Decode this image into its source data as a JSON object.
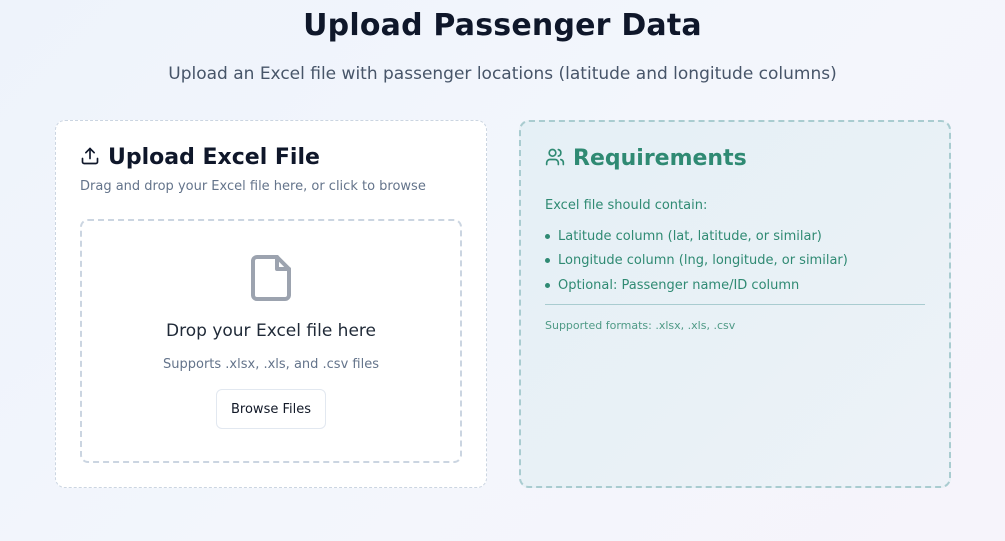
{
  "page": {
    "title": "Upload Passenger Data",
    "subtitle": "Upload an Excel file with passenger locations (latitude and longitude columns)"
  },
  "upload_card": {
    "icon": "upload-icon",
    "title": "Upload Excel File",
    "description": "Drag and drop your Excel file here, or click to browse",
    "dropzone": {
      "icon": "file-icon",
      "title": "Drop your Excel file here",
      "subtitle": "Supports .xlsx, .xls, and .csv files",
      "button_label": "Browse Files"
    }
  },
  "requirements_card": {
    "icon": "users-icon",
    "title": "Requirements",
    "intro": "Excel file should contain:",
    "items": [
      "Latitude column (lat, latitude, or similar)",
      "Longitude column (lng, longitude, or similar)",
      "Optional: Passenger name/ID column"
    ],
    "formats": "Supported formats: .xlsx, .xls, .csv"
  },
  "colors": {
    "accent": "#2f8a73",
    "title": "#0f172a",
    "muted": "#64748b"
  }
}
